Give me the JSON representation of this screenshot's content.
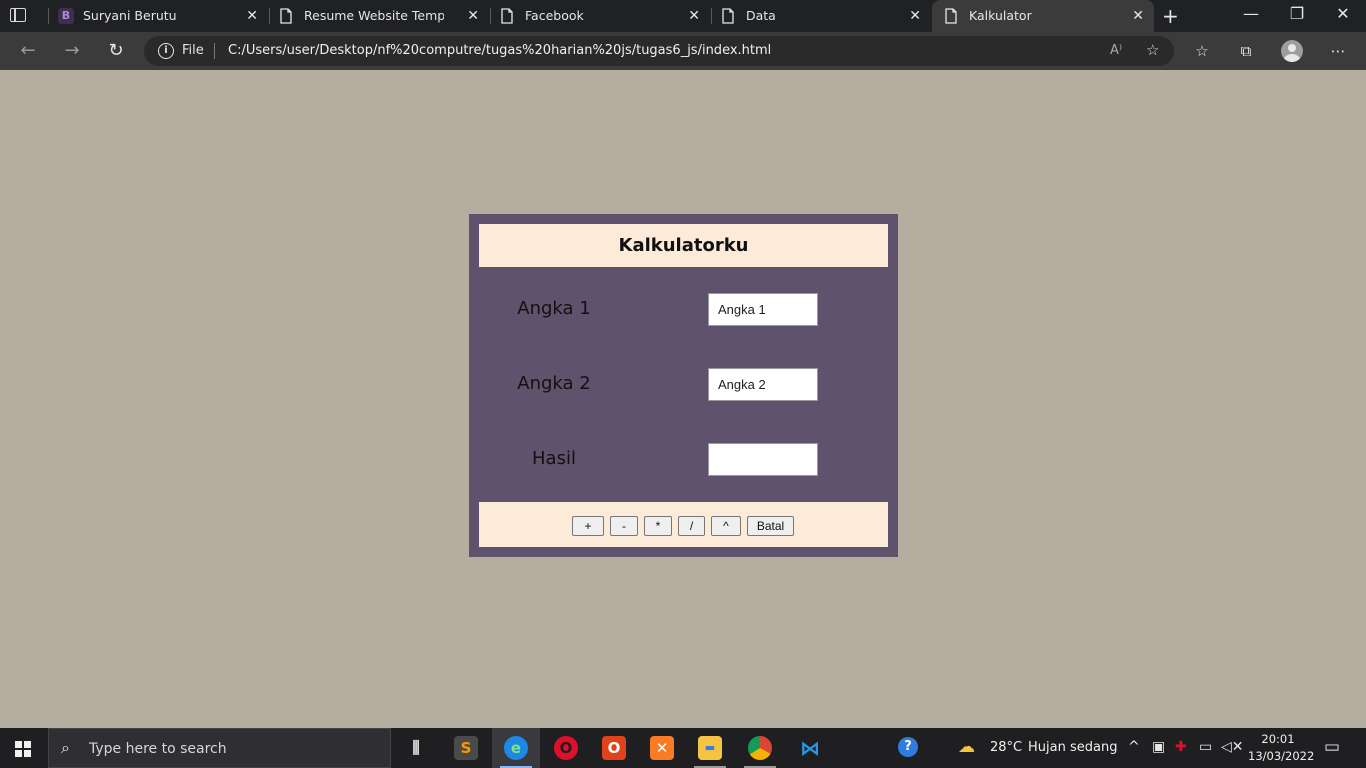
{
  "browser": {
    "tabs": [
      {
        "title": "Suryani Berutu",
        "favicon": "b-icon",
        "active": false
      },
      {
        "title": "Resume Website Template Fr",
        "favicon": "page-icon",
        "active": false
      },
      {
        "title": "Facebook",
        "favicon": "page-icon",
        "active": false
      },
      {
        "title": "Data",
        "favicon": "page-icon",
        "active": false
      },
      {
        "title": "Kalkulator",
        "favicon": "page-icon",
        "active": true
      }
    ],
    "address": {
      "scheme_label": "File",
      "url": "C:/Users/user/Desktop/nf%20computre/tugas%20harian%20js/tugas6_js/index.html"
    }
  },
  "calculator": {
    "title": "Kalkulatorku",
    "fields": [
      {
        "label": "Angka 1",
        "placeholder": "Angka 1",
        "value": ""
      },
      {
        "label": "Angka 2",
        "placeholder": "Angka 2",
        "value": ""
      },
      {
        "label": "Hasil",
        "placeholder": "",
        "value": ""
      }
    ],
    "buttons": [
      "+",
      "-",
      "*",
      "/",
      "^",
      "Batal"
    ],
    "colors": {
      "panel": "#5f526d",
      "header_footer": "#fcebd8",
      "page_background": "#b6ada1"
    }
  },
  "taskbar": {
    "search_placeholder": "Type here to search",
    "weather": {
      "temperature": "28°C",
      "condition": "Hujan sedang"
    },
    "clock": {
      "time": "20:01",
      "date": "13/03/2022"
    }
  }
}
